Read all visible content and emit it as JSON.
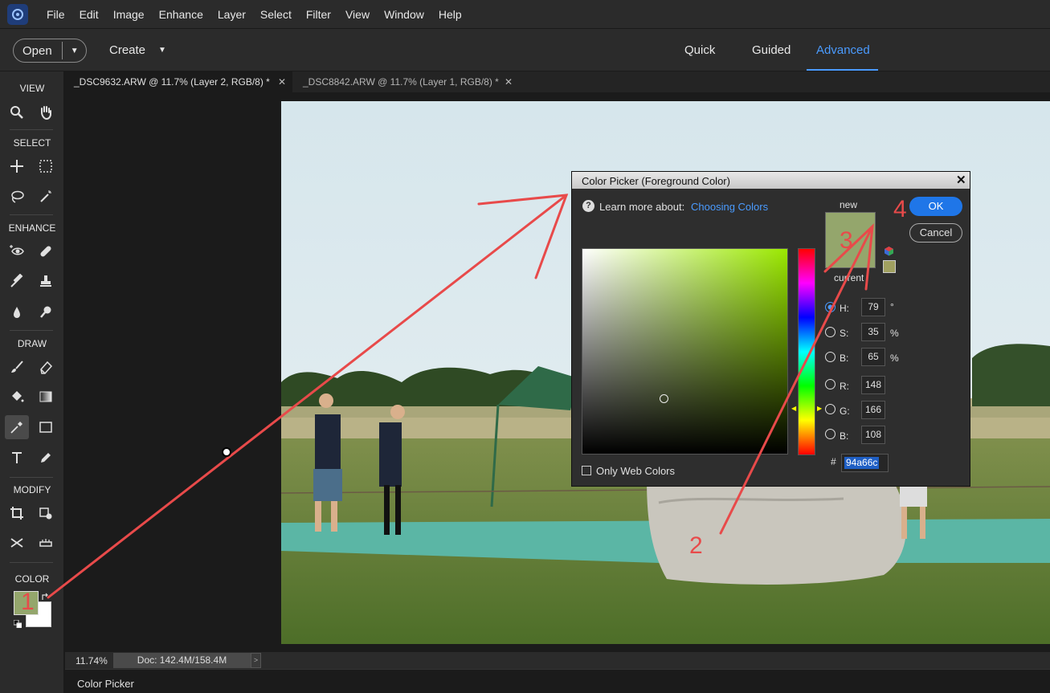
{
  "menubar": {
    "items": [
      "File",
      "Edit",
      "Image",
      "Enhance",
      "Layer",
      "Select",
      "Filter",
      "View",
      "Window",
      "Help"
    ]
  },
  "toolbar": {
    "open_label": "Open",
    "create_label": "Create",
    "modes": [
      "Quick",
      "Guided",
      "Advanced"
    ],
    "active_mode": "Advanced"
  },
  "tools": {
    "sections": {
      "view": "VIEW",
      "select": "SELECT",
      "enhance": "ENHANCE",
      "draw": "DRAW",
      "modify": "MODIFY",
      "color": "COLOR"
    },
    "foreground_color": "#94a66c",
    "background_color": "#ffffff"
  },
  "doc_tabs": [
    {
      "label": "_DSC9632.ARW @ 11.7% (Layer 2, RGB/8) *"
    },
    {
      "label": "_DSC8842.ARW @ 11.7% (Layer 1, RGB/8) *"
    }
  ],
  "status": {
    "zoom": "11.74%",
    "doc_size": "Doc: 142.4M/158.4M",
    "panel_label": "Color Picker"
  },
  "dialog": {
    "title": "Color Picker (Foreground Color)",
    "learn_more": "Learn more about:",
    "learn_more_link": "Choosing Colors",
    "new_label": "new",
    "current_label": "current",
    "ok_label": "OK",
    "cancel_label": "Cancel",
    "only_web_colors": "Only Web Colors",
    "new_color": "#94a66c",
    "current_color": "#94a66c",
    "fields": {
      "h": {
        "label": "H:",
        "value": "79",
        "unit": "°"
      },
      "s": {
        "label": "S:",
        "value": "35",
        "unit": "%"
      },
      "b": {
        "label": "B:",
        "value": "65",
        "unit": "%"
      },
      "r": {
        "label": "R:",
        "value": "148"
      },
      "g": {
        "label": "G:",
        "value": "166"
      },
      "bl": {
        "label": "B:",
        "value": "108"
      }
    },
    "hex_label": "#",
    "hex_value": "94a66c"
  },
  "annotations": {
    "n1": "1",
    "n2": "2",
    "n3": "3",
    "n4": "4"
  }
}
